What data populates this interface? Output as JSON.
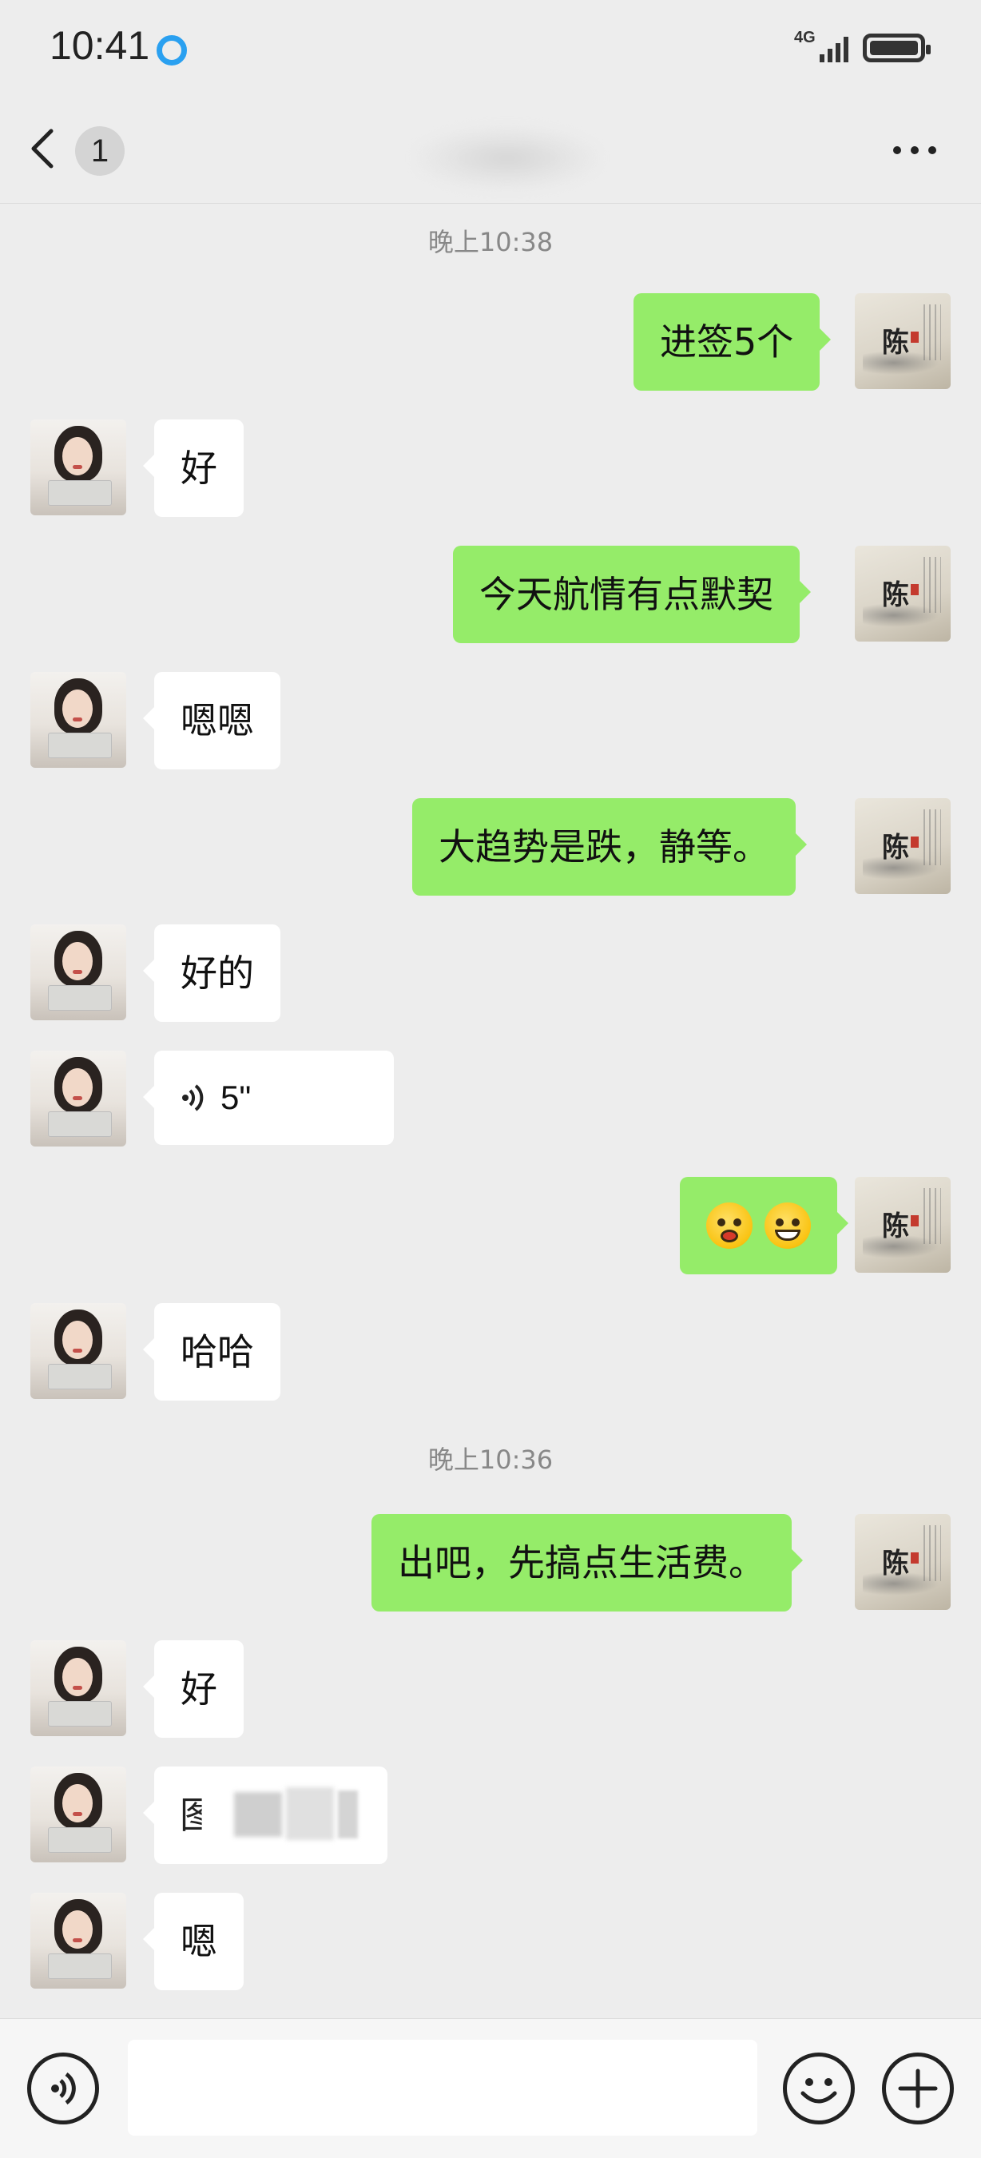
{
  "status_bar": {
    "time": "10:41",
    "network": "4G"
  },
  "header": {
    "back_badge": "1",
    "title": ""
  },
  "messages": [
    {
      "type": "timestamp",
      "text": "晚上10:38"
    },
    {
      "type": "text",
      "side": "right",
      "text": "进签5个"
    },
    {
      "type": "text",
      "side": "left",
      "text": "好"
    },
    {
      "type": "text",
      "side": "right",
      "text": "今天航情有点默契"
    },
    {
      "type": "text",
      "side": "left",
      "text": "嗯嗯"
    },
    {
      "type": "text",
      "side": "right",
      "text": "大趋势是跌，静等。"
    },
    {
      "type": "text",
      "side": "left",
      "text": "好的"
    },
    {
      "type": "voice",
      "side": "left",
      "duration": "5\""
    },
    {
      "type": "emoji",
      "side": "right",
      "emojis": [
        "tongue-face-emoji",
        "grinning-face-emoji"
      ]
    },
    {
      "type": "text",
      "side": "left",
      "text": "哈哈"
    },
    {
      "type": "timestamp",
      "text": "晚上10:36"
    },
    {
      "type": "text",
      "side": "right",
      "text": "出吧，先搞点生活费。"
    },
    {
      "type": "text",
      "side": "left",
      "text": "好"
    },
    {
      "type": "text",
      "side": "left",
      "text": "图发",
      "blurred": true
    },
    {
      "type": "text",
      "side": "left",
      "text": "嗯"
    }
  ],
  "input_bar": {
    "voice_icon": "voice-input-icon",
    "emoji_icon": "emoji-icon",
    "plus_icon": "plus-icon",
    "text_value": ""
  },
  "colors": {
    "background": "#ededed",
    "sent_bubble": "#95ec69",
    "received_bubble": "#ffffff"
  }
}
